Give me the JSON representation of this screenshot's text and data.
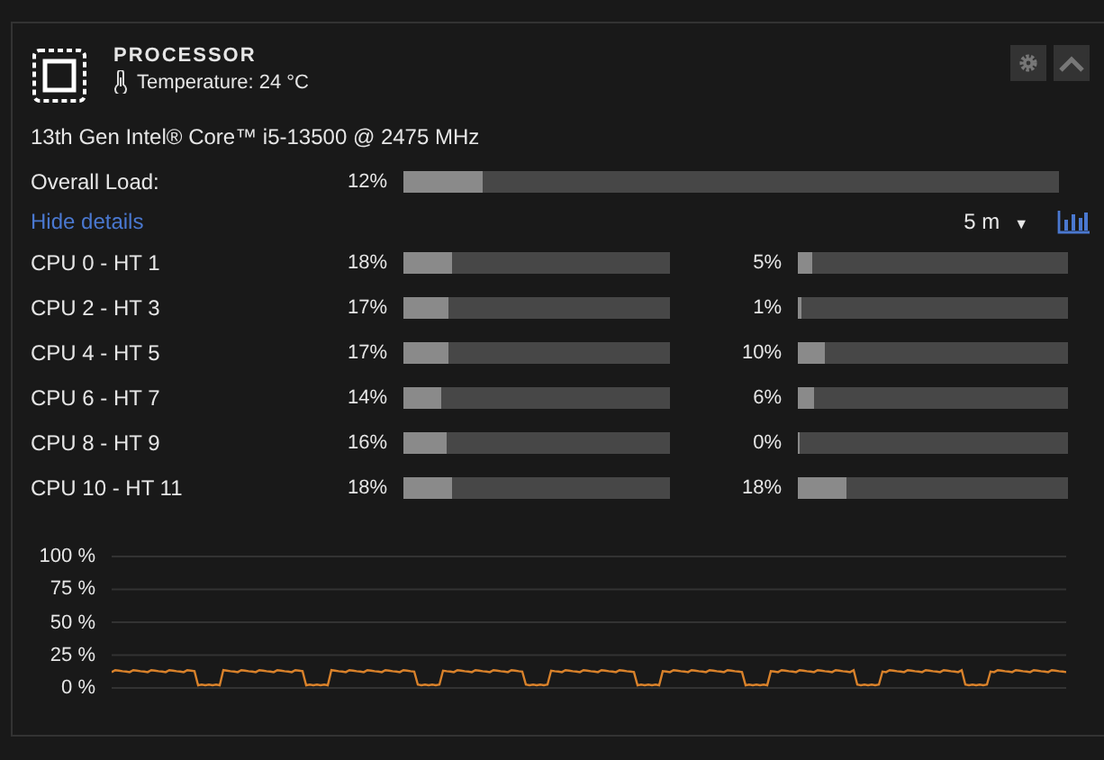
{
  "header": {
    "title": "PROCESSOR",
    "temperature": "Temperature: 24 °C"
  },
  "model": "13th Gen Intel® Core™ i5-13500 @ 2475 MHz",
  "overall": {
    "label": "Overall Load:",
    "reading": "12%",
    "level": 0.12
  },
  "details_link": "Hide details",
  "range": {
    "value": "5 m",
    "caret": "▼"
  },
  "cores": [
    {
      "label": "CPU 0 - HT 1",
      "a": {
        "reading": "18%",
        "level": 0.18
      },
      "b": {
        "reading": "5%",
        "level": 0.05
      }
    },
    {
      "label": "CPU 2 - HT 3",
      "a": {
        "reading": "17%",
        "level": 0.17
      },
      "b": {
        "reading": "1%",
        "level": 0.01
      }
    },
    {
      "label": "CPU 4 - HT 5",
      "a": {
        "reading": "17%",
        "level": 0.17
      },
      "b": {
        "reading": "10%",
        "level": 0.1
      }
    },
    {
      "label": "CPU 6 - HT 7",
      "a": {
        "reading": "14%",
        "level": 0.14
      },
      "b": {
        "reading": "6%",
        "level": 0.06
      }
    },
    {
      "label": "CPU 8 - HT 9",
      "a": {
        "reading": "16%",
        "level": 0.16
      },
      "b": {
        "reading": "0%",
        "level": 0
      }
    },
    {
      "label": "CPU 10 - HT 11",
      "a": {
        "reading": "18%",
        "level": 0.18
      },
      "b": {
        "reading": "18%",
        "level": 0.18
      }
    }
  ],
  "graph": {
    "y_labels": [
      "100 %",
      "75 %",
      "50 %",
      "25 %",
      "0 %"
    ]
  }
}
